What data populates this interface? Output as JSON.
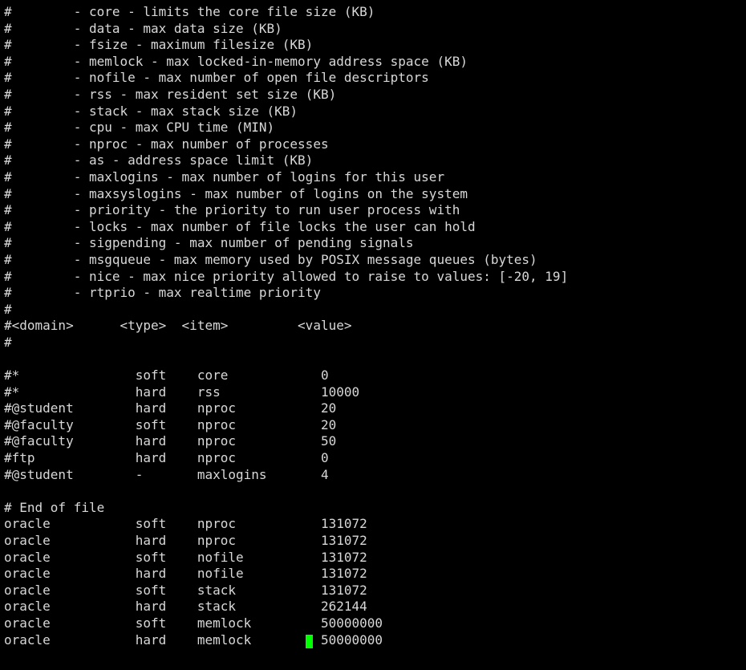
{
  "comments": [
    "#        - core - limits the core file size (KB)",
    "#        - data - max data size (KB)",
    "#        - fsize - maximum filesize (KB)",
    "#        - memlock - max locked-in-memory address space (KB)",
    "#        - nofile - max number of open file descriptors",
    "#        - rss - max resident set size (KB)",
    "#        - stack - max stack size (KB)",
    "#        - cpu - max CPU time (MIN)",
    "#        - nproc - max number of processes",
    "#        - as - address space limit (KB)",
    "#        - maxlogins - max number of logins for this user",
    "#        - maxsyslogins - max number of logins on the system",
    "#        - priority - the priority to run user process with",
    "#        - locks - max number of file locks the user can hold",
    "#        - sigpending - max number of pending signals",
    "#        - msgqueue - max memory used by POSIX message queues (bytes)",
    "#        - nice - max nice priority allowed to raise to values: [-20, 19]",
    "#        - rtprio - max realtime priority",
    "#"
  ],
  "header": {
    "domain": "#<domain>",
    "type": "<type>",
    "item": "<item>",
    "value": "<value>"
  },
  "hash_line": "#",
  "commented_rows": [
    {
      "domain": "#*",
      "type": "soft",
      "item": "core",
      "value": "0"
    },
    {
      "domain": "#*",
      "type": "hard",
      "item": "rss",
      "value": "10000"
    },
    {
      "domain": "#@student",
      "type": "hard",
      "item": "nproc",
      "value": "20"
    },
    {
      "domain": "#@faculty",
      "type": "soft",
      "item": "nproc",
      "value": "20"
    },
    {
      "domain": "#@faculty",
      "type": "hard",
      "item": "nproc",
      "value": "50"
    },
    {
      "domain": "#ftp",
      "type": "hard",
      "item": "nproc",
      "value": "0"
    },
    {
      "domain": "#@student",
      "type": "-",
      "item": "maxlogins",
      "value": "4"
    }
  ],
  "end_line": "# End of file",
  "rows": [
    {
      "domain": "oracle",
      "type": "soft",
      "item": "nproc",
      "value": "131072"
    },
    {
      "domain": "oracle",
      "type": "hard",
      "item": "nproc",
      "value": "131072"
    },
    {
      "domain": "oracle",
      "type": "soft",
      "item": "nofile",
      "value": "131072"
    },
    {
      "domain": "oracle",
      "type": "hard",
      "item": "nofile",
      "value": "131072"
    },
    {
      "domain": "oracle",
      "type": "soft",
      "item": "stack",
      "value": "131072"
    },
    {
      "domain": "oracle",
      "type": "hard",
      "item": "stack",
      "value": "262144"
    },
    {
      "domain": "oracle",
      "type": "soft",
      "item": "memlock",
      "value": "50000000"
    },
    {
      "domain": "oracle",
      "type": "hard",
      "item": "memlock",
      "value": "50000000"
    }
  ],
  "colors": {
    "background": "#000000",
    "text": "#d8d8d8",
    "cursor": "#00ff00"
  }
}
